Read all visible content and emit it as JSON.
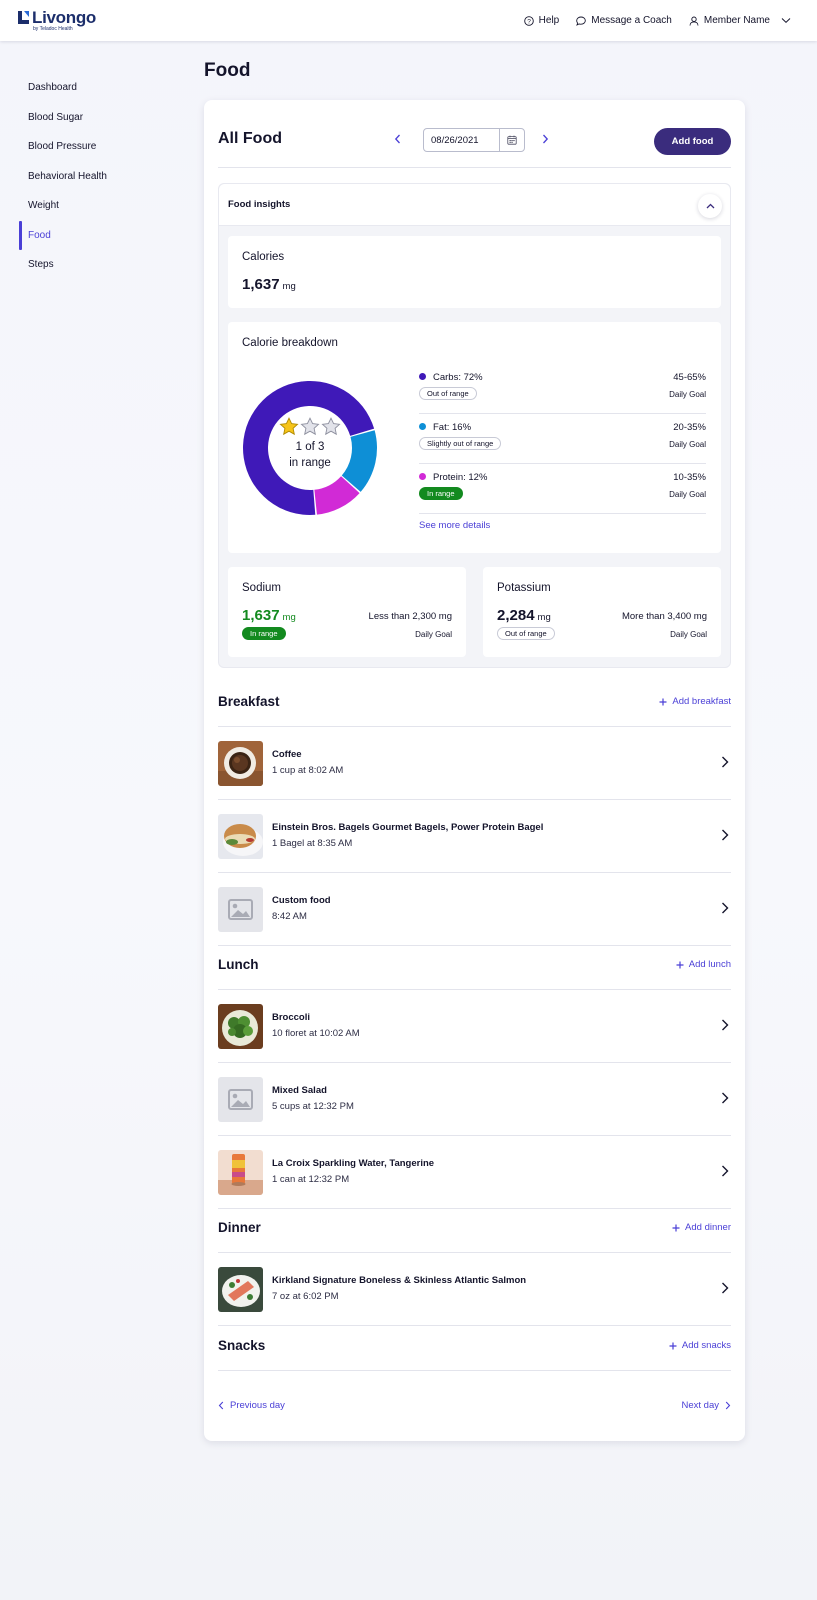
{
  "header": {
    "brand": "Livongo",
    "brand_sub": "by Teladoc Health",
    "help": "Help",
    "message_coach": "Message a Coach",
    "member": "Member Name"
  },
  "sidebar": {
    "items": [
      {
        "label": "Dashboard"
      },
      {
        "label": "Blood Sugar"
      },
      {
        "label": "Blood Pressure"
      },
      {
        "label": "Behavioral Health"
      },
      {
        "label": "Weight"
      },
      {
        "label": "Food",
        "active": true
      },
      {
        "label": "Steps"
      }
    ]
  },
  "page": {
    "title": "Food"
  },
  "all_food": {
    "title": "All Food",
    "date": "08/26/2021",
    "add_food": "Add food"
  },
  "insights": {
    "title": "Food insights",
    "calories": {
      "title": "Calories",
      "value": "1,637",
      "unit": "mg"
    },
    "breakdown": {
      "title": "Calorie breakdown",
      "center_line1": "1 of 3",
      "center_line2": "in range",
      "stars_filled": 1,
      "stars_total": 3,
      "macros": [
        {
          "name": "Carbs: 72%",
          "percent": 72,
          "goal": "45-65%",
          "goal_label": "Daily Goal",
          "status": "Out of range",
          "color": "#3f19b8"
        },
        {
          "name": "Fat: 16%",
          "percent": 16,
          "goal": "20-35%",
          "goal_label": "Daily Goal",
          "status": "Slightly out of range",
          "color": "#0e8fd6"
        },
        {
          "name": "Protein: 12%",
          "percent": 12,
          "goal": "10-35%",
          "goal_label": "Daily Goal",
          "status": "In range",
          "color": "#d12ad6"
        }
      ],
      "see_more": "See more details"
    },
    "sodium": {
      "title": "Sodium",
      "value": "1,637",
      "unit": "mg",
      "goal": "Less than 2,300 mg",
      "goal_label": "Daily Goal",
      "status": "In range",
      "color": "#138a1f"
    },
    "potassium": {
      "title": "Potassium",
      "value": "2,284",
      "unit": "mg",
      "goal": "More than 3,400 mg",
      "goal_label": "Daily Goal",
      "status": "Out of range"
    }
  },
  "meals": {
    "breakfast": {
      "title": "Breakfast",
      "add": "Add breakfast",
      "items": [
        {
          "name": "Coffee",
          "detail": "1 cup at 8:02 AM",
          "icon": "coffee-photo"
        },
        {
          "name": "Einstein Bros. Bagels Gourmet Bagels, Power Protein Bagel",
          "detail": "1 Bagel at 8:35 AM",
          "icon": "bagel-photo"
        },
        {
          "name": "Custom food",
          "detail": "8:42 AM",
          "icon": "image-placeholder-icon"
        }
      ]
    },
    "lunch": {
      "title": "Lunch",
      "add": "Add lunch",
      "items": [
        {
          "name": "Broccoli",
          "detail": "10 floret at 10:02 AM",
          "icon": "broccoli-photo"
        },
        {
          "name": "Mixed Salad",
          "detail": "5 cups at 12:32 PM",
          "icon": "image-placeholder-icon"
        },
        {
          "name": "La Croix Sparkling Water, Tangerine",
          "detail": "1 can at 12:32 PM",
          "icon": "can-photo"
        }
      ]
    },
    "dinner": {
      "title": "Dinner",
      "add": "Add dinner",
      "items": [
        {
          "name": "Kirkland Signature Boneless & Skinless Atlantic Salmon",
          "detail": "7 oz at 6:02 PM",
          "icon": "salmon-photo"
        }
      ]
    },
    "snacks": {
      "title": "Snacks",
      "add": "Add snacks",
      "items": []
    }
  },
  "day_nav": {
    "previous": "Previous day",
    "next": "Next day"
  },
  "colors": {
    "accent": "#4a3fd6",
    "primary_button": "#3a2c7d",
    "in_range": "#138a1f"
  }
}
